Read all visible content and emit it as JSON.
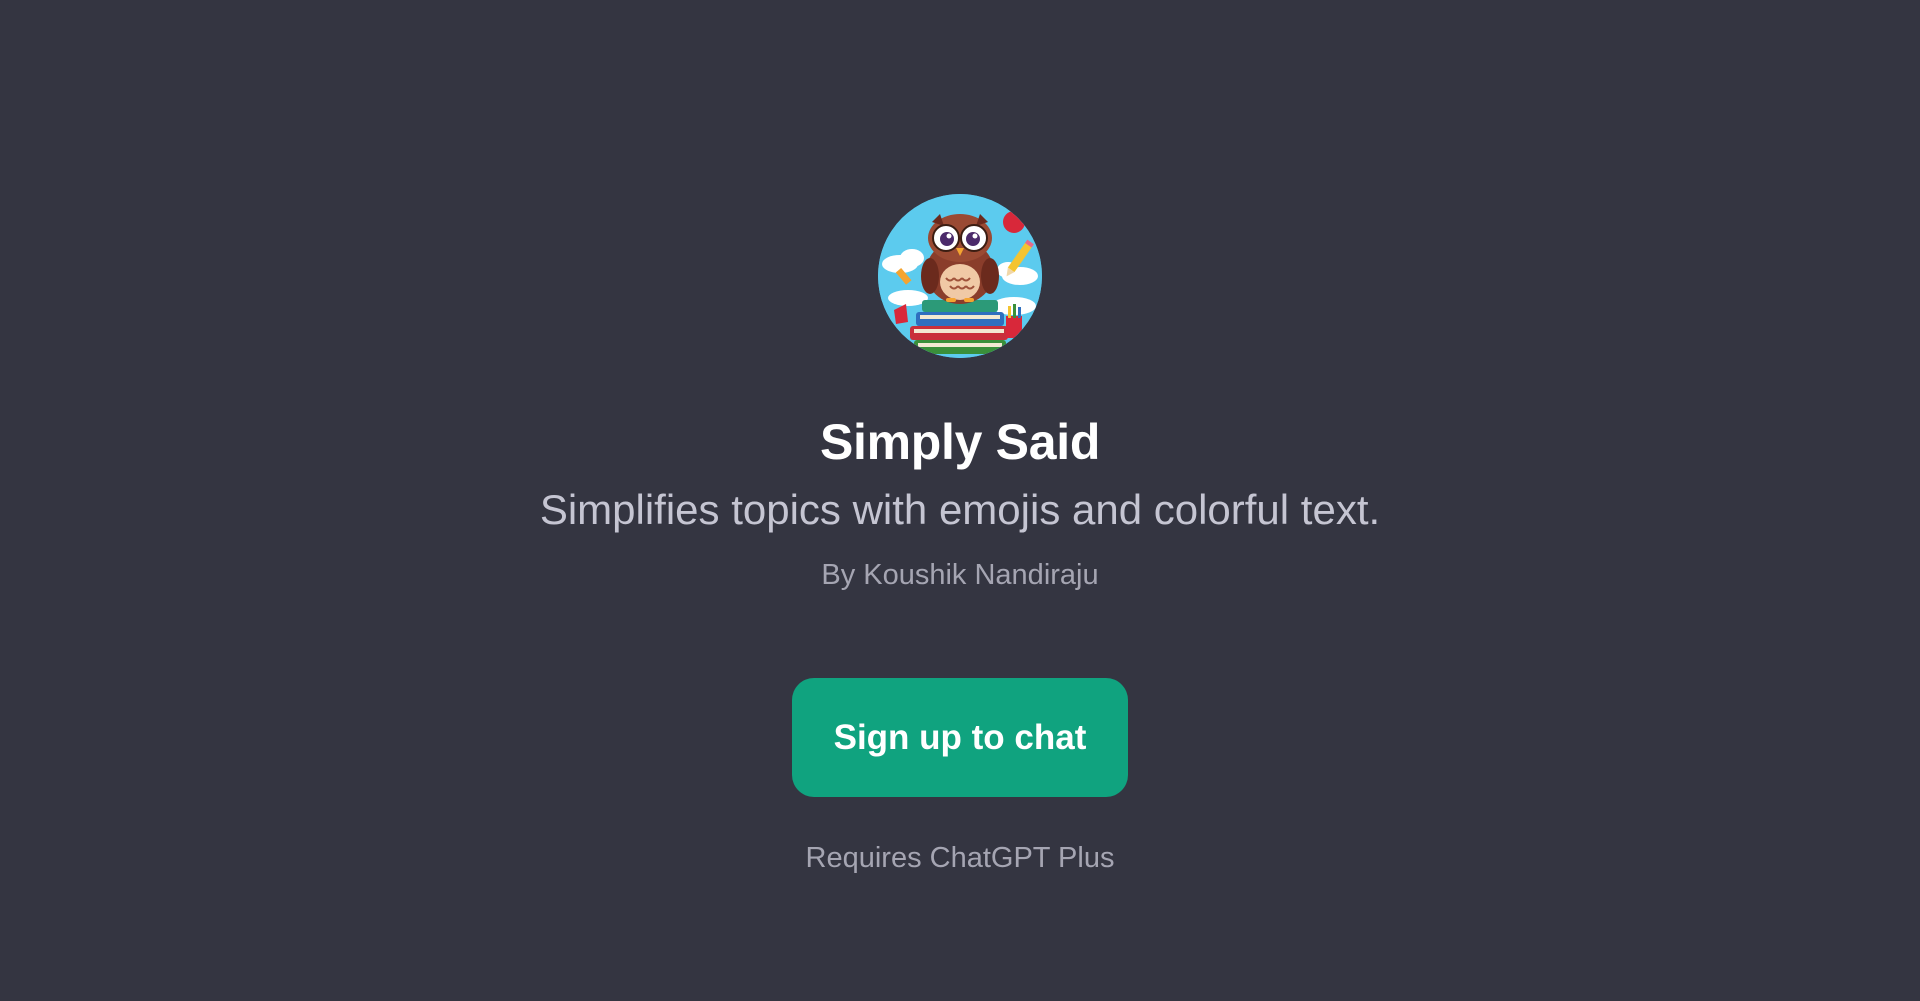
{
  "gpt": {
    "avatar_icon": "owl-on-books-icon",
    "title": "Simply Said",
    "description": "Simplifies topics with emojis and colorful text.",
    "author": "By Koushik Nandiraju"
  },
  "cta": {
    "signup_label": "Sign up to chat",
    "requirement": "Requires ChatGPT Plus"
  },
  "colors": {
    "background": "#343541",
    "button": "#10a37f",
    "title": "#ffffff",
    "description": "#c5c5d2",
    "muted": "#a5a5b2"
  }
}
